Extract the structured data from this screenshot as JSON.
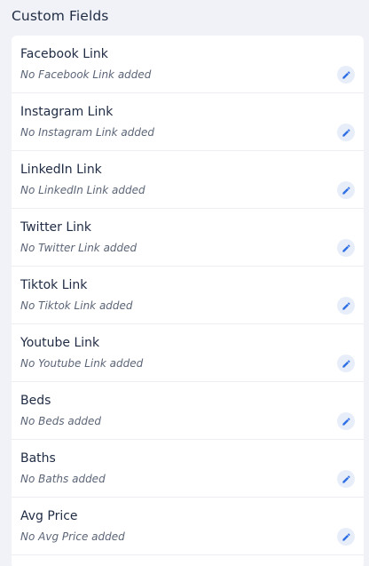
{
  "section": {
    "title": "Custom Fields"
  },
  "colors": {
    "accent": "#2f6fe4",
    "title": "#1f2b43",
    "muted": "#5b6577",
    "background": "#f0f2f7"
  },
  "fields": [
    {
      "label": "Facebook Link",
      "value": "No Facebook Link added",
      "icon": "pencil-icon"
    },
    {
      "label": "Instagram Link",
      "value": "No Instagram Link added",
      "icon": "pencil-icon"
    },
    {
      "label": "LinkedIn Link",
      "value": "No LinkedIn Link added",
      "icon": "pencil-icon"
    },
    {
      "label": "Twitter Link",
      "value": "No Twitter Link added",
      "icon": "pencil-icon"
    },
    {
      "label": "Tiktok Link",
      "value": "No Tiktok Link added",
      "icon": "pencil-icon"
    },
    {
      "label": "Youtube Link",
      "value": "No Youtube Link added",
      "icon": "pencil-icon"
    },
    {
      "label": "Beds",
      "value": "No Beds added",
      "icon": "pencil-icon"
    },
    {
      "label": "Baths",
      "value": "No Baths added",
      "icon": "pencil-icon"
    },
    {
      "label": "Avg Price",
      "value": "No Avg Price added",
      "icon": "pencil-icon"
    }
  ]
}
